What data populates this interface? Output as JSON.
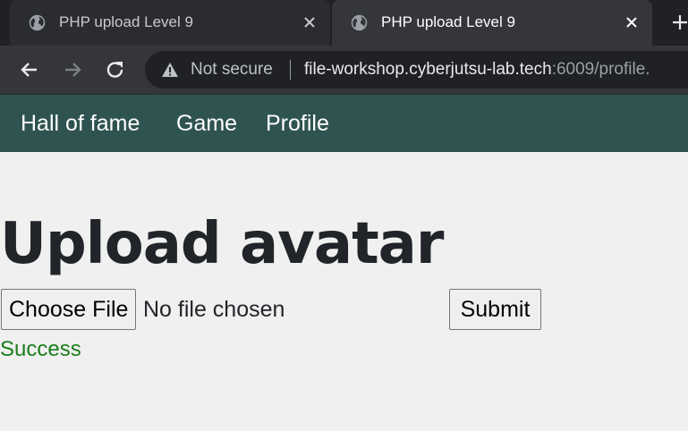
{
  "tabs": [
    {
      "title": "PHP upload Level 9",
      "active": false
    },
    {
      "title": "PHP upload Level 9",
      "active": true
    }
  ],
  "toolbar": {
    "security_label": "Not secure",
    "url_host": "file-workshop.cyberjutsu-lab.tech",
    "url_path": ":6009/profile."
  },
  "nav": {
    "items": [
      "Hall of fame",
      "Game",
      "Profile"
    ]
  },
  "main": {
    "heading": "Upload avatar",
    "choose_file_label": "Choose File",
    "file_status": "No file chosen",
    "submit_label": "Submit",
    "result_message": "Success"
  },
  "colors": {
    "navbar_bg": "#2f5350",
    "success_text": "#1b7d1b"
  }
}
